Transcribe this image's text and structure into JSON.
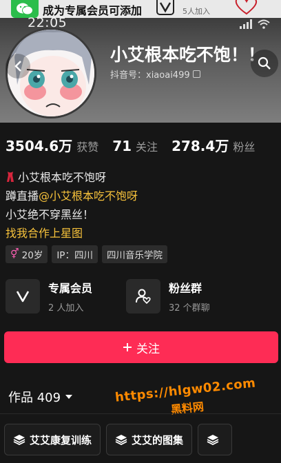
{
  "notice": {
    "text": "成为专属会员可添加",
    "join_text": "5人加入"
  },
  "status_bar": {
    "time": "22:05"
  },
  "profile": {
    "name": "小艾根本吃不饱！！",
    "handle": "抖音号：xiaoai499",
    "stats": [
      {
        "value": "3504.6万",
        "label": "获赞"
      },
      {
        "value": "71",
        "label": "关注"
      },
      {
        "value": "278.4万",
        "label": "粉丝"
      }
    ],
    "bio_line1": "小艾根本吃不饱呀",
    "bio_line2_prefix": "蹲直播",
    "bio_line2_link": "@小艾根本吃不饱呀",
    "bio_line3": "小艾绝不穿黑丝！",
    "bio_line4": "找我合作上星图",
    "tags": [
      "20岁",
      "IP：四川",
      "四川音乐学院"
    ]
  },
  "cards": {
    "member_title": "专属会员",
    "member_sub": "2 人加入",
    "fans_title": "粉丝群",
    "fans_sub": "32 个群聊"
  },
  "follow_button": {
    "label": "关注",
    "icon": "plus-icon"
  },
  "works": {
    "label": "作品 409"
  },
  "watermark": {
    "url": "https://hlgw02.com",
    "sub": "黑料网"
  },
  "collections": [
    {
      "label": "艾艾康复训练",
      "icon": "layers-icon"
    },
    {
      "label": "艾艾的图集",
      "icon": "layers-icon"
    },
    {
      "label": "",
      "icon": "layers-icon"
    }
  ],
  "colors": {
    "accent": "#fe2c55",
    "link": "#f7c23b",
    "watermark": "#ff8a00"
  }
}
